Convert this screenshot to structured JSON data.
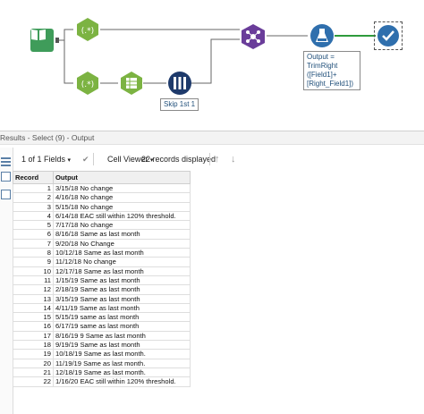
{
  "canvas": {
    "formula_label": "(.*)",
    "annotation_skip": "Skip 1st 1",
    "annotation_output": "Output = TrimRight ([Field1]+ [Right_Field1])"
  },
  "results": {
    "title": "Results - Select (9) - Output",
    "fields_selector": "1 of 1 Fields",
    "viewer": "Cell Viewer",
    "records_info": "22 records displayed",
    "columns": [
      "Record",
      "Output"
    ],
    "rows": [
      [
        "1",
        "3/15/18  No change"
      ],
      [
        "2",
        "4/16/18  No change"
      ],
      [
        "3",
        "5/15/18  No change"
      ],
      [
        "4",
        "6/14/18  EAC still within 120% threshold."
      ],
      [
        "5",
        "7/17/18  No change"
      ],
      [
        "6",
        "8/16/18  Same as last month"
      ],
      [
        "7",
        "9/20/18  No Change"
      ],
      [
        "8",
        "10/12/18  Same as last month"
      ],
      [
        "9",
        "11/12/18  No change"
      ],
      [
        "10",
        "12/17/18  Same as last month"
      ],
      [
        "11",
        "1/15/19  Same as last month"
      ],
      [
        "12",
        "2/18/19  Same as last month"
      ],
      [
        "13",
        "3/15/19  Same as last month"
      ],
      [
        "14",
        "4/11/19  Same as last month"
      ],
      [
        "15",
        "5/15/19  same as last month"
      ],
      [
        "16",
        "6/17/19  same as last month"
      ],
      [
        "17",
        "8/16/19 9 Same as last month"
      ],
      [
        "18",
        "9/19/19  Same as last month"
      ],
      [
        "19",
        "10/18/19  Same as last month."
      ],
      [
        "20",
        "11/19/19  Same as last month."
      ],
      [
        "21",
        "12/18/19  Same as last month."
      ],
      [
        "22",
        "1/16/20  EAC still within 120% threshold."
      ]
    ]
  },
  "colors": {
    "formula_green": "#7cb342",
    "input_green": "#3f9c5a",
    "join_purple": "#6a3d9a",
    "output_blue": "#2f6fad",
    "dark_navy": "#1e3a6b"
  },
  "icons": [
    "book-input-icon",
    "formula-icon",
    "select-icon",
    "sample-icon",
    "join-icon",
    "formula-flask-icon",
    "browse-check-icon",
    "arrow-up-icon",
    "arrow-down-icon"
  ]
}
